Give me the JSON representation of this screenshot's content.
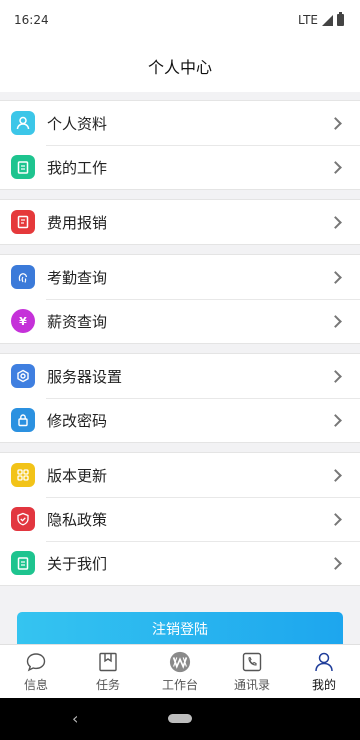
{
  "status": {
    "time": "16:24",
    "network": "LTE"
  },
  "header": {
    "title": "个人中心"
  },
  "menu": {
    "groups": [
      {
        "items": [
          {
            "label": "个人资料",
            "icon": "user-icon",
            "color": "#3cc6e8"
          },
          {
            "label": "我的工作",
            "icon": "clipboard-icon",
            "color": "#1ec48f"
          }
        ]
      },
      {
        "items": [
          {
            "label": "费用报销",
            "icon": "receipt-icon",
            "color": "#e5393b"
          }
        ]
      },
      {
        "items": [
          {
            "label": "考勤查询",
            "icon": "fingerprint-icon",
            "color": "#3b7ad9"
          },
          {
            "label": "薪资查询",
            "icon": "yen-icon",
            "color": "#c531d9"
          }
        ]
      },
      {
        "items": [
          {
            "label": "服务器设置",
            "icon": "settings-icon",
            "color": "#3f7fe0"
          },
          {
            "label": "修改密码",
            "icon": "lock-icon",
            "color": "#2b91e0"
          }
        ]
      },
      {
        "items": [
          {
            "label": "版本更新",
            "icon": "grid-icon",
            "color": "#f2c318"
          },
          {
            "label": "隐私政策",
            "icon": "shield-icon",
            "color": "#e2363f"
          },
          {
            "label": "关于我们",
            "icon": "clipboard-icon",
            "color": "#1ec48f"
          }
        ]
      }
    ]
  },
  "logout": {
    "label": "注销登陆"
  },
  "tabs": [
    {
      "label": "信息",
      "icon": "chat-bubble-icon"
    },
    {
      "label": "任务",
      "icon": "bookmark-icon"
    },
    {
      "label": "工作台",
      "icon": "workbench-logo-icon"
    },
    {
      "label": "通讯录",
      "icon": "phone-icon"
    },
    {
      "label": "我的",
      "icon": "person-icon",
      "active": true
    }
  ]
}
